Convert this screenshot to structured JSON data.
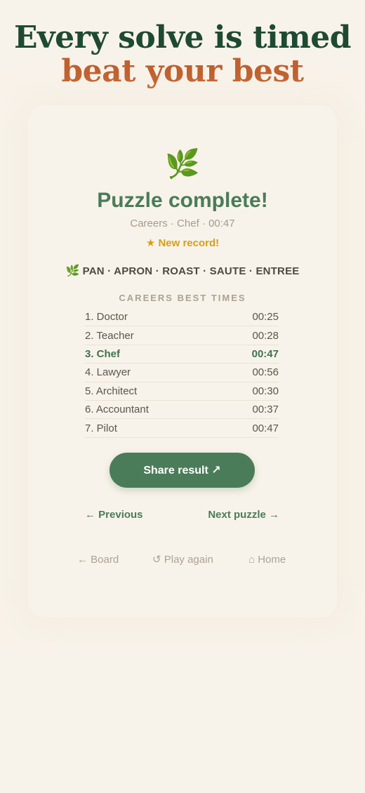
{
  "headline": {
    "line1": "Every solve is timed",
    "line2": "beat your best"
  },
  "result": {
    "leaf_icon": "🌿",
    "title": "Puzzle complete!",
    "subtitle": "Careers · Chef · 00:47",
    "record": "★ New record!",
    "words_icon": "🌿",
    "words": "PAN · APRON · ROAST · SAUTE · ENTREE"
  },
  "best_times": {
    "title": "CAREERS BEST TIMES",
    "rows": [
      {
        "label": "1. Doctor",
        "time": "00:25"
      },
      {
        "label": "2. Teacher",
        "time": "00:28"
      },
      {
        "label": "3. Chef",
        "time": "00:47"
      },
      {
        "label": "4. Lawyer",
        "time": "00:56"
      },
      {
        "label": "5. Architect",
        "time": "00:30"
      },
      {
        "label": "6. Accountant",
        "time": "00:37"
      },
      {
        "label": "7. Pilot",
        "time": "00:47"
      }
    ]
  },
  "actions": {
    "share": "Share result ↗",
    "previous": "← Previous",
    "next": "Next puzzle →"
  },
  "footer": {
    "board": "← Board",
    "play_again": "↺ Play again",
    "home": "⌂ Home"
  },
  "colors": {
    "background": "#f8f3ea",
    "headline_dark": "#1e4a32",
    "headline_accent": "#c0602e",
    "primary_green": "#4a7c59",
    "record_gold": "#d4a017"
  }
}
